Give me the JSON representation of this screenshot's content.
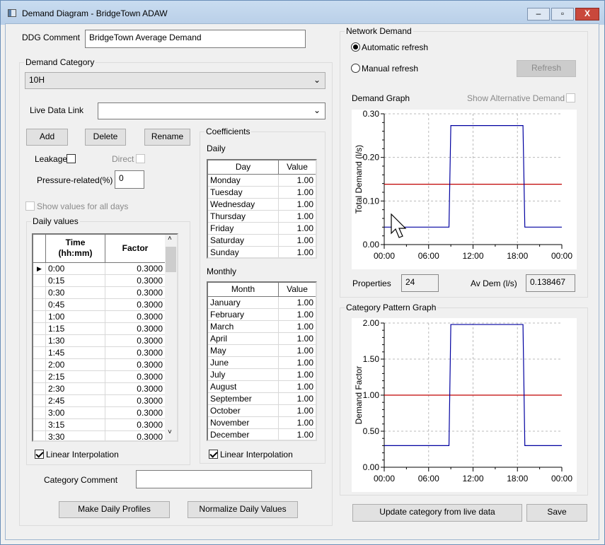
{
  "window": {
    "title": "Demand Diagram - BridgeTown ADAW",
    "minimize": "minimize",
    "maximize": "maximize",
    "close": "X"
  },
  "ddg_comment": {
    "label": "DDG Comment",
    "value": "BridgeTown Average Demand"
  },
  "demand_category": {
    "label": "Demand Category",
    "selected": "10H",
    "live_data_label": "Live Data Link",
    "live_data_value": "",
    "add": "Add",
    "delete": "Delete",
    "rename": "Rename",
    "leakage": "Leakage",
    "leakage_checked": false,
    "direct": "Direct",
    "direct_checked": false,
    "pressure_label": "Pressure-related(%)",
    "pressure_value": "0",
    "show_all_days": "Show values for all days",
    "show_all_days_checked": false,
    "category_comment_label": "Category Comment",
    "category_comment_value": "",
    "make_daily": "Make Daily Profiles",
    "normalize": "Normalize Daily Values"
  },
  "daily_values": {
    "label": "Daily values",
    "col_time": "Time\n(hh:mm)",
    "col_factor": "Factor",
    "linear": "Linear Interpolation",
    "linear_checked": true,
    "rows": [
      [
        "0:00",
        "0.3000"
      ],
      [
        "0:15",
        "0.3000"
      ],
      [
        "0:30",
        "0.3000"
      ],
      [
        "0:45",
        "0.3000"
      ],
      [
        "1:00",
        "0.3000"
      ],
      [
        "1:15",
        "0.3000"
      ],
      [
        "1:30",
        "0.3000"
      ],
      [
        "1:45",
        "0.3000"
      ],
      [
        "2:00",
        "0.3000"
      ],
      [
        "2:15",
        "0.3000"
      ],
      [
        "2:30",
        "0.3000"
      ],
      [
        "2:45",
        "0.3000"
      ],
      [
        "3:00",
        "0.3000"
      ],
      [
        "3:15",
        "0.3000"
      ],
      [
        "3:30",
        "0.3000"
      ]
    ]
  },
  "coefficients": {
    "label": "Coefficients",
    "daily_label": "Daily",
    "day_col": "Day",
    "value_col": "Value",
    "daily": [
      [
        "Monday",
        "1.00"
      ],
      [
        "Tuesday",
        "1.00"
      ],
      [
        "Wednesday",
        "1.00"
      ],
      [
        "Thursday",
        "1.00"
      ],
      [
        "Friday",
        "1.00"
      ],
      [
        "Saturday",
        "1.00"
      ],
      [
        "Sunday",
        "1.00"
      ]
    ],
    "monthly_label": "Monthly",
    "month_col": "Month",
    "monthly": [
      [
        "January",
        "1.00"
      ],
      [
        "February",
        "1.00"
      ],
      [
        "March",
        "1.00"
      ],
      [
        "April",
        "1.00"
      ],
      [
        "May",
        "1.00"
      ],
      [
        "June",
        "1.00"
      ],
      [
        "July",
        "1.00"
      ],
      [
        "August",
        "1.00"
      ],
      [
        "September",
        "1.00"
      ],
      [
        "October",
        "1.00"
      ],
      [
        "November",
        "1.00"
      ],
      [
        "December",
        "1.00"
      ]
    ],
    "linear": "Linear Interpolation",
    "linear_checked": true
  },
  "network_demand": {
    "label": "Network Demand",
    "auto": "Automatic refresh",
    "manual": "Manual refresh",
    "selected": "auto",
    "refresh": "Refresh",
    "graph_label": "Demand Graph",
    "show_alt": "Show Alternative Demand",
    "properties_label": "Properties",
    "properties_value": "24",
    "avdem_label": "Av Dem (l/s)",
    "avdem_value": "0.138467"
  },
  "pattern": {
    "label": "Category Pattern Graph"
  },
  "footer": {
    "update": "Update category from live data",
    "save": "Save"
  },
  "chart_data": [
    {
      "type": "line",
      "ylabel": "Total Demand (l/s)",
      "ylim": [
        0,
        0.3
      ],
      "yticks": [
        "0.00",
        "0.10",
        "0.20",
        "0.30"
      ],
      "xticks": [
        "00:00",
        "06:00",
        "12:00",
        "18:00",
        "00:00"
      ],
      "grid": true,
      "series": [
        {
          "color": "#0000a0",
          "points": [
            [
              "00:00",
              0.04
            ],
            [
              "08:45",
              0.04
            ],
            [
              "09:00",
              0.273
            ],
            [
              "18:45",
              0.273
            ],
            [
              "19:00",
              0.04
            ],
            [
              "24:00",
              0.04
            ]
          ]
        }
      ],
      "reference": {
        "value": 0.138467,
        "color": "#c00000"
      }
    },
    {
      "type": "line",
      "ylabel": "Demand Factor",
      "ylim": [
        0,
        2
      ],
      "yticks": [
        "0.00",
        "0.50",
        "1.00",
        "1.50",
        "2.00"
      ],
      "xticks": [
        "00:00",
        "06:00",
        "12:00",
        "18:00",
        "00:00"
      ],
      "grid": true,
      "series": [
        {
          "color": "#0000a0",
          "points": [
            [
              "00:00",
              0.3
            ],
            [
              "08:45",
              0.3
            ],
            [
              "09:00",
              1.98
            ],
            [
              "18:45",
              1.98
            ],
            [
              "19:00",
              0.3
            ],
            [
              "24:00",
              0.3
            ]
          ]
        }
      ],
      "reference": {
        "value": 1.0,
        "color": "#c00000"
      }
    }
  ]
}
